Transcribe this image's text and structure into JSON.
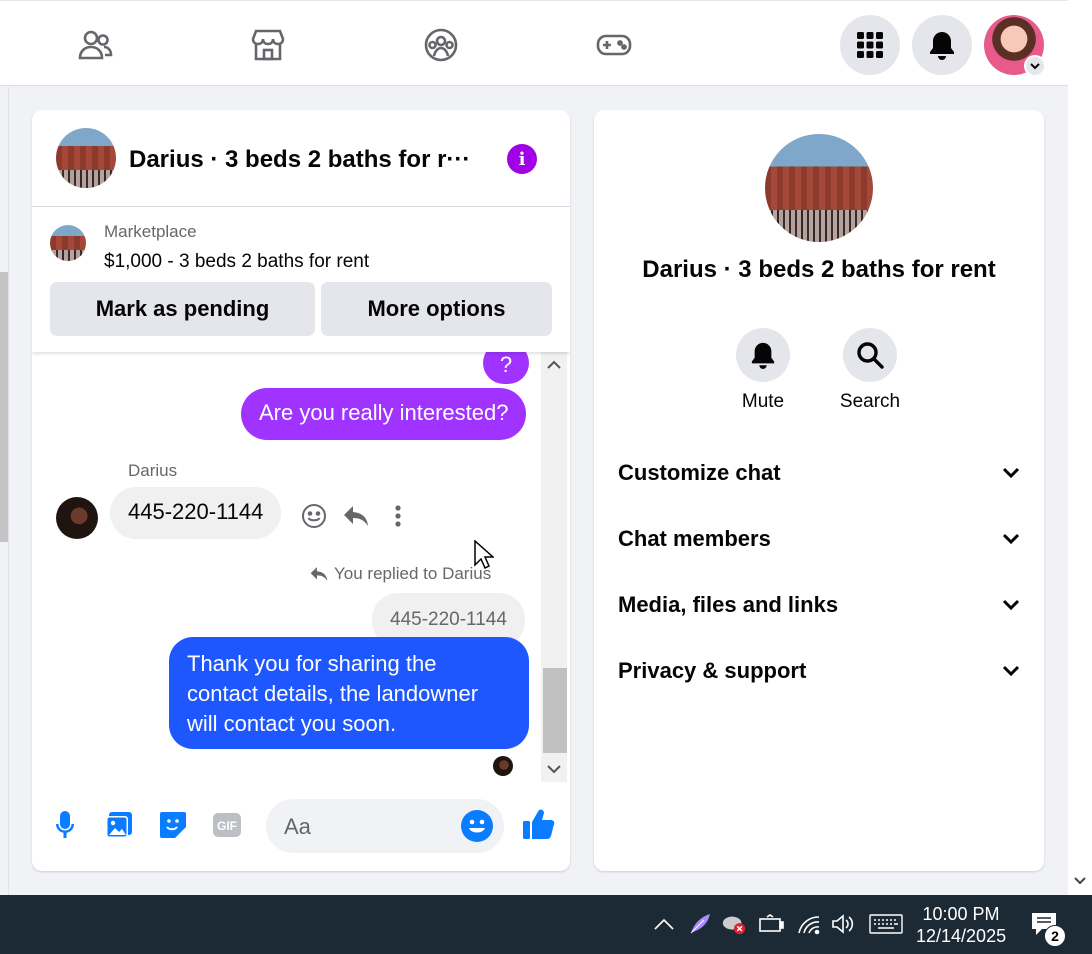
{
  "nav": {
    "icons": [
      "friends-icon",
      "marketplace-icon",
      "groups-icon",
      "gaming-icon"
    ],
    "right": [
      "menu-grid-icon",
      "notifications-icon",
      "account-avatar"
    ]
  },
  "chat": {
    "title": "Darius · 3 beds 2 baths for r···",
    "listing": {
      "label": "Marketplace",
      "price_title": "$1,000 - 3 beds 2 baths for rent",
      "pending_btn": "Mark as pending",
      "more_btn": "More options"
    },
    "messages": {
      "partial_out": "?",
      "out1": "Are you really interested?",
      "sender": "Darius",
      "in1": "445-220-1144",
      "replied_note": "You replied to Darius",
      "quoted": "445-220-1144",
      "out2_line1": "Thank you for sharing the",
      "out2_line2": "contact details, the landowner",
      "out2_line3": "will contact you soon."
    },
    "composer": {
      "placeholder": "Aa",
      "icons": [
        "microphone-icon",
        "image-icon",
        "sticker-icon",
        "gif-icon",
        "emoji-icon",
        "like-icon"
      ]
    }
  },
  "info": {
    "name": "Darius · 3 beds 2 baths for rent",
    "actions": [
      {
        "label": "Mute"
      },
      {
        "label": "Search"
      }
    ],
    "sections": [
      {
        "label": "Customize chat"
      },
      {
        "label": "Chat members"
      },
      {
        "label": "Media, files and links"
      },
      {
        "label": "Privacy & support"
      }
    ]
  },
  "taskbar": {
    "time": "10:00 PM",
    "date": "12/14/2025",
    "notification_count": "2"
  },
  "colors": {
    "accent_purple": "#a033ff",
    "accent_blue": "#1f57ff",
    "messenger_blue": "#0a7cff",
    "info_purple": "#a200e6"
  }
}
